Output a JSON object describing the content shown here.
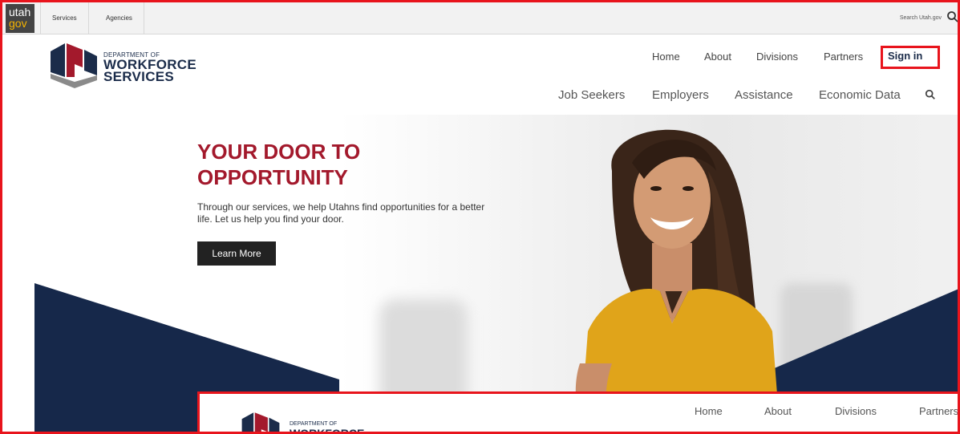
{
  "utahbar": {
    "logo_top": "utah",
    "logo_bottom": "gov",
    "services": "Services",
    "agencies": "Agencies",
    "search_placeholder": "Search Utah.gov",
    "search_icon": "search-icon"
  },
  "header": {
    "logo_dept": "DEPARTMENT OF",
    "logo_line1": "WORKFORCE",
    "logo_line2": "SERVICES",
    "topnav": {
      "home": "Home",
      "about": "About",
      "divisions": "Divisions",
      "partners": "Partners",
      "signin": "Sign in"
    },
    "mainnav": {
      "job_seekers": "Job Seekers",
      "employers": "Employers",
      "assistance": "Assistance",
      "economic_data": "Economic Data"
    }
  },
  "hero": {
    "title": "YOUR DOOR TO OPPORTUNITY",
    "body": "Through our services, we help Utahns find opportunities for a better life. Let us help you find your door.",
    "button": "Learn More"
  },
  "inset": {
    "logo_dept": "DEPARTMENT OF",
    "logo_line1": "WORKFORCE",
    "nav": {
      "home": "Home",
      "about": "About",
      "divisions": "Divisions",
      "partners": "Partners"
    }
  },
  "colors": {
    "highlight": "#e8141c",
    "brand_navy": "#1b2c4a",
    "brand_red": "#a3192c",
    "hero_navy": "#16284a"
  }
}
